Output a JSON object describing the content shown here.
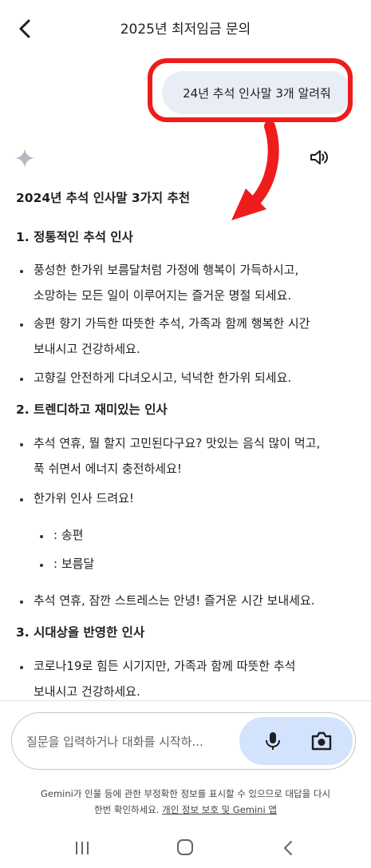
{
  "header": {
    "title": "2025년 최저임금 문의",
    "back_icon": "chevron-left-icon"
  },
  "user_message": {
    "text": "24년 추석 인사말 3개 알려줘"
  },
  "annotation": {
    "highlight_color": "#ef1c1c"
  },
  "response": {
    "title": "2024년 추석 인사말 3가지 추천",
    "sections": [
      {
        "heading": "1. 정통적인 추석 인사",
        "items": [
          {
            "lines": [
              "풍성한 한가위 보름달처럼 가정에 행복이 가득하시고,",
              "소망하는 모든 일이 이루어지는 즐거운 명절 되세요."
            ]
          },
          {
            "lines": [
              "송편 향기 가득한 따뜻한 추석, 가족과 함께 행복한 시간",
              "보내시고 건강하세요."
            ]
          },
          {
            "lines": [
              "고향길 안전하게 다녀오시고, 넉넉한 한가위 되세요."
            ]
          }
        ]
      },
      {
        "heading": "2. 트렌디하고 재미있는 인사",
        "items": [
          {
            "lines": [
              "추석 연휴, 뭘 할지 고민된다구요? 맛있는 음식 많이 먹고,",
              "푹 쉬면서 에너지 충전하세요!"
            ]
          },
          {
            "lines": [
              "한가위 인사 드려요!"
            ],
            "sub_items": [
              ": 송편",
              ": 보름달"
            ]
          },
          {
            "lines": [
              "추석 연휴, 잠깐 스트레스는 안녕! 즐거운 시간 보내세요."
            ]
          }
        ]
      },
      {
        "heading": "3. 시대상을 반영한 인사",
        "items": [
          {
            "lines": [
              "코로나19로 힘든 시기지만, 가족과 함께 따뜻한 추석",
              "보내시고 건강하세요."
            ]
          }
        ]
      }
    ]
  },
  "input": {
    "placeholder": "질문을 입력하거나 대화를 시작하...",
    "mic_icon": "microphone-icon",
    "camera_icon": "camera-icon"
  },
  "disclaimer": {
    "line1": "Gemini가 인물 등에 관한 부정확한 정보를 표시할 수 있으므로 대답을 다시",
    "line2_prefix": "한번 확인하세요. ",
    "link": "개인 정보 보호 및 Gemini 앱"
  },
  "colors": {
    "bubble_bg": "#e9eef6",
    "action_pill_bg": "#d3e3fd",
    "arrow": "#ef1c1c"
  }
}
